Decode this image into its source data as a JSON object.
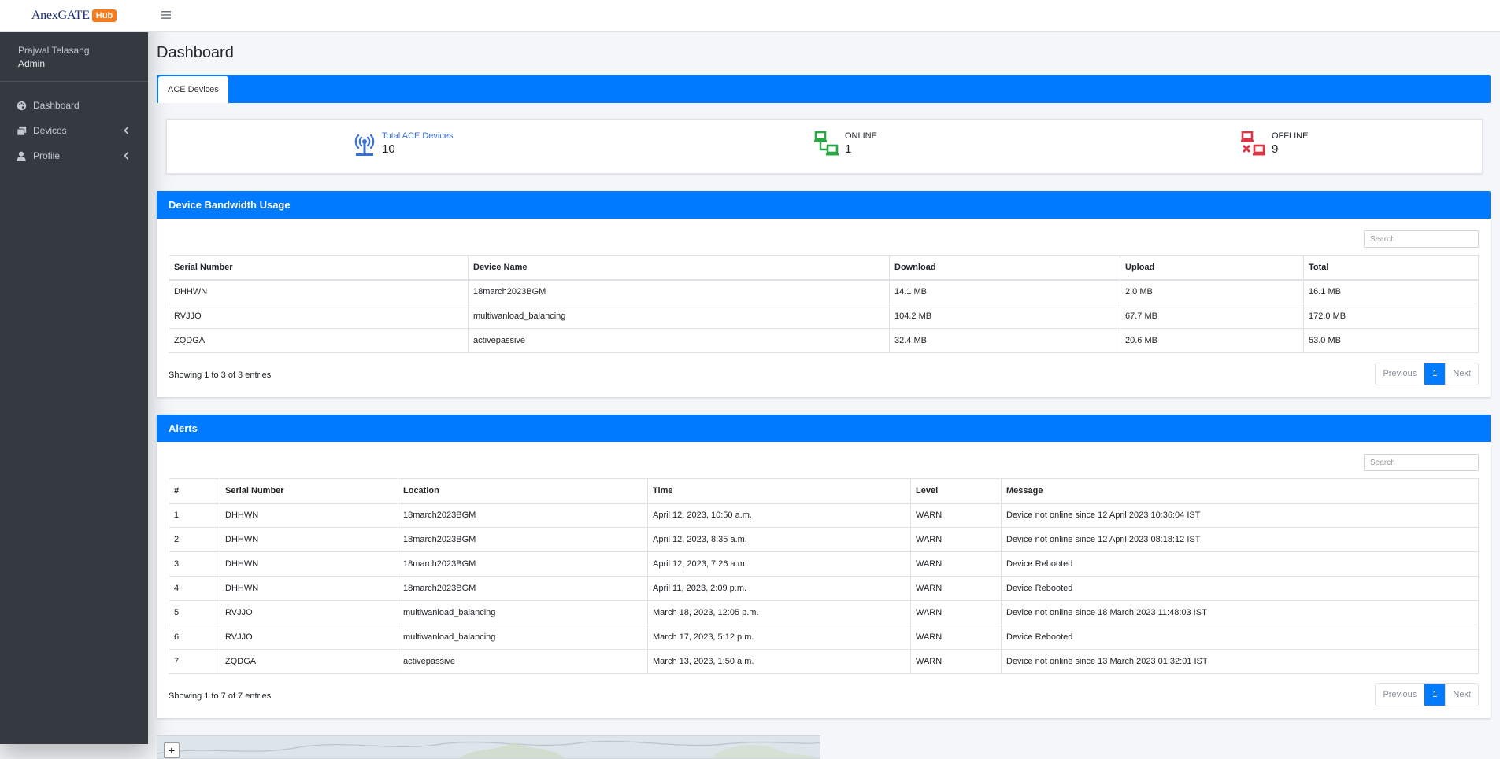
{
  "brand": {
    "name": "AnexGATE",
    "badge": "Hub"
  },
  "user": {
    "name": "Prajwal Telasang",
    "role": "Admin"
  },
  "sidebar": {
    "items": [
      {
        "label": "Dashboard",
        "icon": "palette-icon"
      },
      {
        "label": "Devices",
        "icon": "copy-icon",
        "has_chevron": true
      },
      {
        "label": "Profile",
        "icon": "user-icon",
        "has_chevron": true
      }
    ]
  },
  "page": {
    "title": "Dashboard"
  },
  "tabs": [
    {
      "label": "ACE Devices",
      "active": true
    }
  ],
  "stats": {
    "total": {
      "label": "Total ACE Devices",
      "value": "10",
      "icon": "antenna-icon",
      "color": "#3b6fd4"
    },
    "online": {
      "label": "ONLINE",
      "value": "1",
      "icon": "network-online-icon",
      "color": "#28a745"
    },
    "offline": {
      "label": "OFFLINE",
      "value": "9",
      "icon": "network-offline-icon",
      "color": "#dc3545"
    }
  },
  "bandwidth": {
    "title": "Device Bandwidth Usage",
    "search_placeholder": "Search",
    "columns": [
      "Serial Number",
      "Device Name",
      "Download",
      "Upload",
      "Total"
    ],
    "rows": [
      [
        "DHHWN",
        "18march2023BGM",
        "14.1 MB",
        "2.0 MB",
        "16.1 MB"
      ],
      [
        "RVJJO",
        "multiwanload_balancing",
        "104.2 MB",
        "67.7 MB",
        "172.0 MB"
      ],
      [
        "ZQDGA",
        "activepassive",
        "32.4 MB",
        "20.6 MB",
        "53.0 MB"
      ]
    ],
    "entries_info": "Showing 1 to 3 of 3 entries",
    "pagination": {
      "previous": "Previous",
      "page": "1",
      "next": "Next"
    }
  },
  "alerts": {
    "title": "Alerts",
    "search_placeholder": "Search",
    "columns": [
      "#",
      "Serial Number",
      "Location",
      "Time",
      "Level",
      "Message"
    ],
    "rows": [
      [
        "1",
        "DHHWN",
        "18march2023BGM",
        "April 12, 2023, 10:50 a.m.",
        "WARN",
        "Device not online since 12 April 2023 10:36:04 IST"
      ],
      [
        "2",
        "DHHWN",
        "18march2023BGM",
        "April 12, 2023, 8:35 a.m.",
        "WARN",
        "Device not online since 12 April 2023 08:18:12 IST"
      ],
      [
        "3",
        "DHHWN",
        "18march2023BGM",
        "April 12, 2023, 7:26 a.m.",
        "WARN",
        "Device Rebooted"
      ],
      [
        "4",
        "DHHWN",
        "18march2023BGM",
        "April 11, 2023, 2:09 p.m.",
        "WARN",
        "Device Rebooted"
      ],
      [
        "5",
        "RVJJO",
        "multiwanload_balancing",
        "March 18, 2023, 12:05 p.m.",
        "WARN",
        "Device not online since 18 March 2023 11:48:03 IST"
      ],
      [
        "6",
        "RVJJO",
        "multiwanload_balancing",
        "March 17, 2023, 5:12 p.m.",
        "WARN",
        "Device Rebooted"
      ],
      [
        "7",
        "ZQDGA",
        "activepassive",
        "March 13, 2023, 1:50 a.m.",
        "WARN",
        "Device not online since 13 March 2023 01:32:01 IST"
      ]
    ],
    "entries_info": "Showing 1 to 7 of 7 entries",
    "pagination": {
      "previous": "Previous",
      "page": "1",
      "next": "Next"
    }
  },
  "map": {
    "zoom_in": "+"
  },
  "colors": {
    "primary": "#007bff",
    "sidebar": "#343a40",
    "brand_badge": "#f57c1f"
  }
}
